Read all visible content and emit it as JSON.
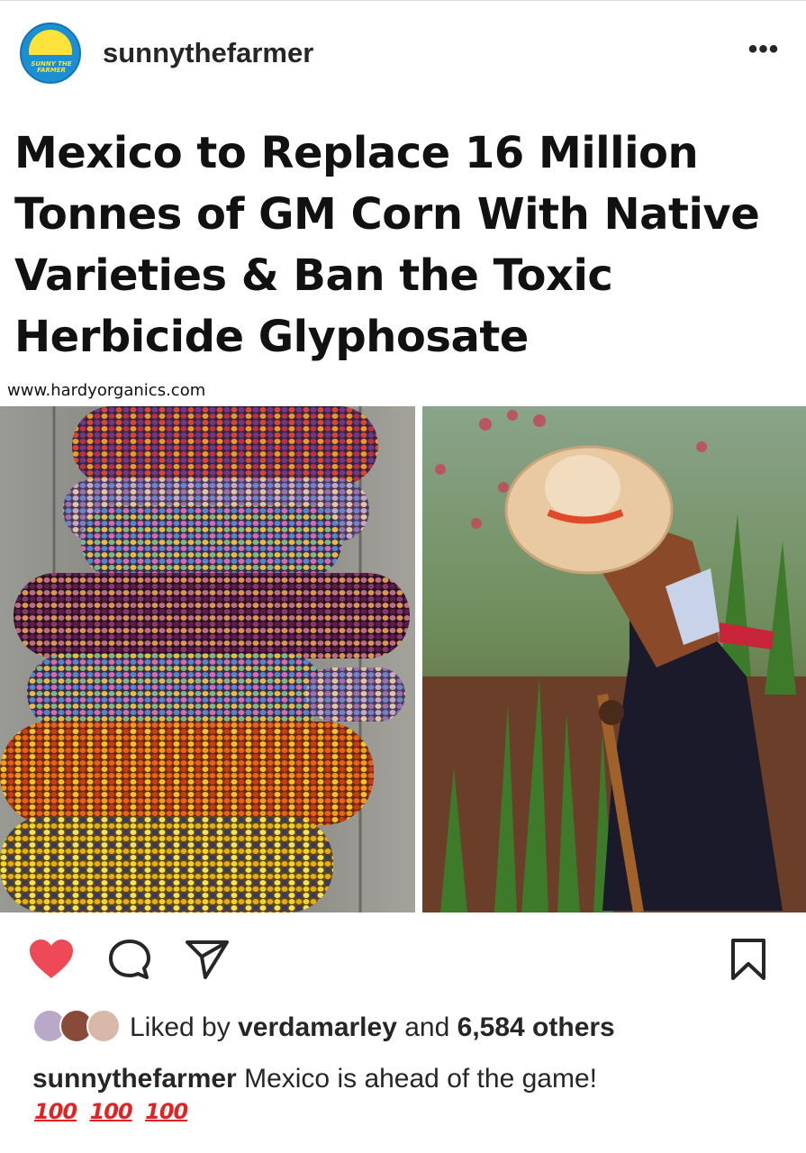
{
  "header": {
    "username": "sunnythefarmer",
    "avatar_text": "SUNNY THE FARMER",
    "more_label": "•••"
  },
  "post": {
    "headline": "Mexico to Replace 16 Million Tonnes of GM Corn With Native Varieties & Ban the Toxic Herbicide Glyphosate",
    "source": "www.hardyorganics.com",
    "images": [
      {
        "name": "multicolored-corn-photo"
      },
      {
        "name": "farmer-with-hoe-photo"
      }
    ]
  },
  "actions": {
    "like_icon": "heart-icon",
    "comment_icon": "comment-icon",
    "share_icon": "share-icon",
    "save_icon": "bookmark-icon",
    "liked_color": "#ed4956"
  },
  "likes": {
    "prefix": "Liked by",
    "user": "verdamarley",
    "middle": "and",
    "count": "6,584 others"
  },
  "caption": {
    "username": "sunnythefarmer",
    "text": "Mexico is ahead of the game!",
    "emojis": [
      "100",
      "100",
      "100"
    ]
  }
}
